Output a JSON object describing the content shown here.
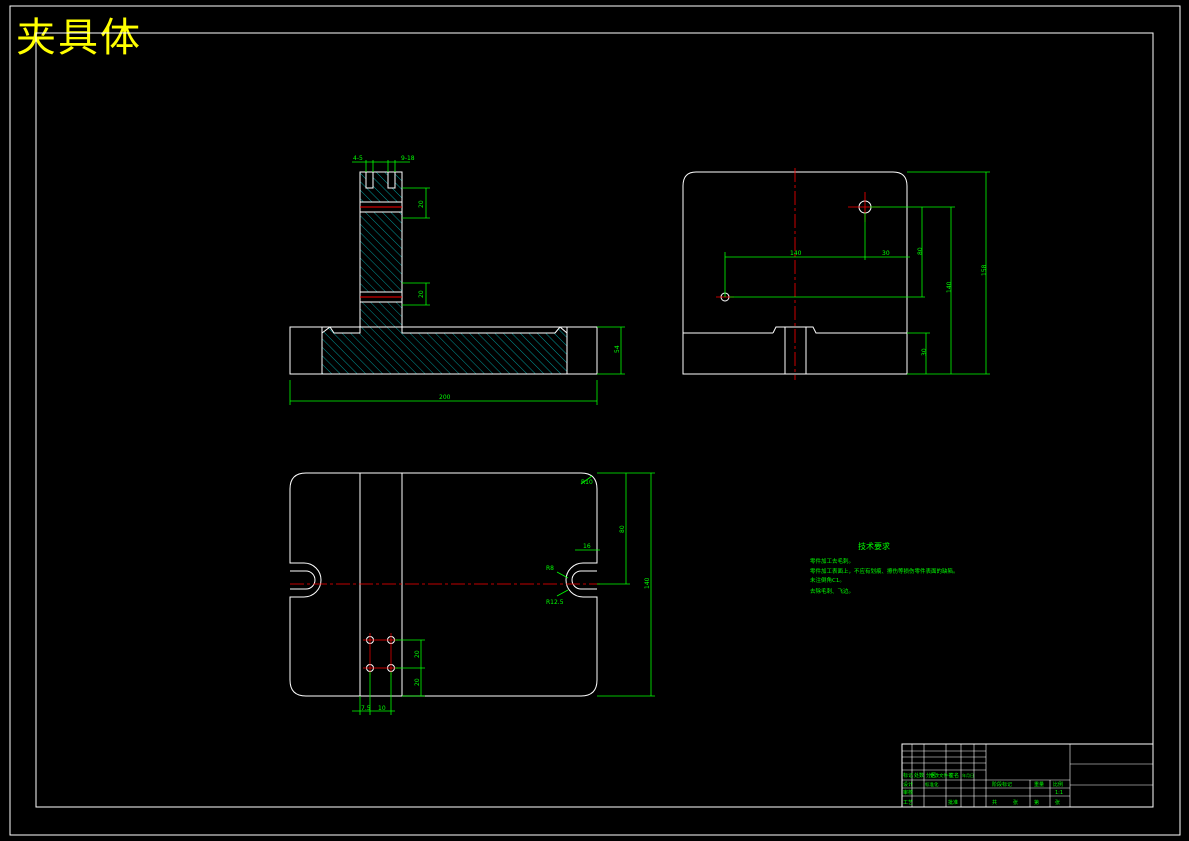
{
  "drawing_title": "夹具体",
  "front_view": {
    "top_dims": [
      "4-5",
      "9-18"
    ],
    "side_dims": [
      "20",
      "20",
      "54"
    ],
    "width_dim": "200"
  },
  "side_view": {
    "dims": [
      "140",
      "30",
      "80",
      "140",
      "158",
      "30"
    ]
  },
  "top_view": {
    "dims": [
      "R10",
      "R8",
      "R12.5",
      "16",
      "80",
      "140",
      "20",
      "20",
      "7.5",
      "10"
    ]
  },
  "tech_requirements": {
    "title": "技术要求",
    "lines": [
      "零件加工去毛刺。",
      "零件加工表面上，不应有划痕、擦伤等损伤零件表面的缺陷。",
      "未注倒角C1。",
      "去除毛刺、飞边。"
    ]
  },
  "title_block": {
    "left_labels": [
      "标记",
      "处数",
      "分区",
      "更改文件号",
      "签名",
      "年月日",
      "设计",
      "标准化",
      "审核",
      "工艺",
      "批准"
    ],
    "stage_labels": [
      "阶段标记",
      "重量",
      "比例"
    ],
    "scale": "1:1",
    "sheet_labels": [
      "共",
      "张",
      "第",
      "张"
    ]
  },
  "colors": {
    "background": "#000000",
    "outline": "#ffffff",
    "dimension": "#00ff00",
    "centerline": "#ff0000",
    "hatch": "#00ffff",
    "title_text": "#ffff00"
  }
}
